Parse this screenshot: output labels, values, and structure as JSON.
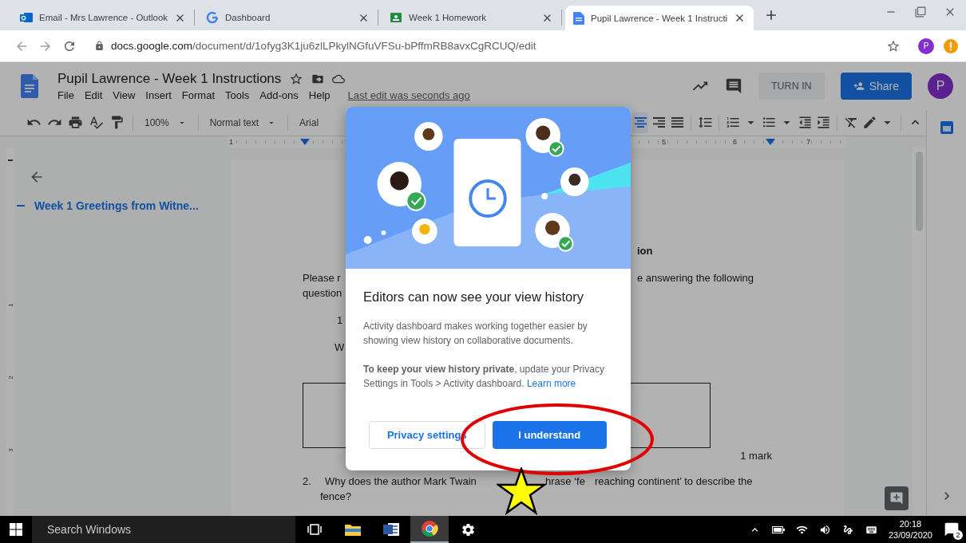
{
  "browser": {
    "tabs": [
      {
        "kind": "mail",
        "title": "Email - Mrs Lawrence - Outlook",
        "selected": false
      },
      {
        "kind": "search",
        "title": "Dashboard",
        "selected": false
      },
      {
        "kind": "board",
        "title": "Week 1 Homework",
        "selected": false
      },
      {
        "kind": "doc",
        "title": "Pupil Lawrence - Week 1 Instructi",
        "selected": true
      }
    ],
    "url": "docs.google.com/document/d/1ofyg3K1ju6zlLPkylNGfuVFSu-bPffmRB8avxCgRCUQ/edit",
    "profile_initial": "P"
  },
  "docs": {
    "title": "Pupil Lawrence - Week 1 Instructions",
    "menus": [
      "File",
      "Edit",
      "View",
      "Insert",
      "Format",
      "Tools",
      "Add-ons",
      "Help"
    ],
    "last_edit": "Last edit was seconds ago",
    "turn_in": "TURN IN",
    "share": "Share",
    "avatar_initial": "P",
    "toolbar": {
      "zoom": "100%",
      "style": "Normal text",
      "font": "Arial",
      "alignment": [
        {
          "kind": "center",
          "selected": true
        },
        {
          "kind": "right",
          "selected": false
        },
        {
          "kind": "justify",
          "selected": false
        }
      ]
    },
    "ruler": [
      "1",
      "5",
      "6",
      "7"
    ],
    "vertical_ruler": [
      "1",
      "2",
      "3"
    ],
    "outline": {
      "heading": "Week 1 Greetings from Witne..."
    },
    "page": {
      "heading_end": "ion",
      "para_start": "Please r",
      "para_end": "e answering the following",
      "para_line2": "question",
      "item_number": "1",
      "item_start": "W",
      "mark": "1 mark",
      "q2_number": "2.",
      "q2_parts": [
        "Why does the author Mark Twain",
        "hrase ‘fe",
        "reaching continent’ to describe the"
      ],
      "q2_line2": "fence?"
    }
  },
  "dialog": {
    "title": "Editors can now see your view history",
    "body": "Activity dashboard makes working together easier by showing view history on collaborative documents.",
    "privacy_note": "**To keep your view history private**, update your Privacy Settings in Tools > Activity dashboard.",
    "link": "Learn more",
    "buttons": [
      {
        "kind": "secondary",
        "label": "Privacy settings"
      },
      {
        "kind": "primary",
        "label": "I understand"
      }
    ]
  },
  "taskbar": {
    "search_placeholder": "Search Windows",
    "time": "20:18",
    "date": "23/09/2020",
    "notifications": "2"
  }
}
